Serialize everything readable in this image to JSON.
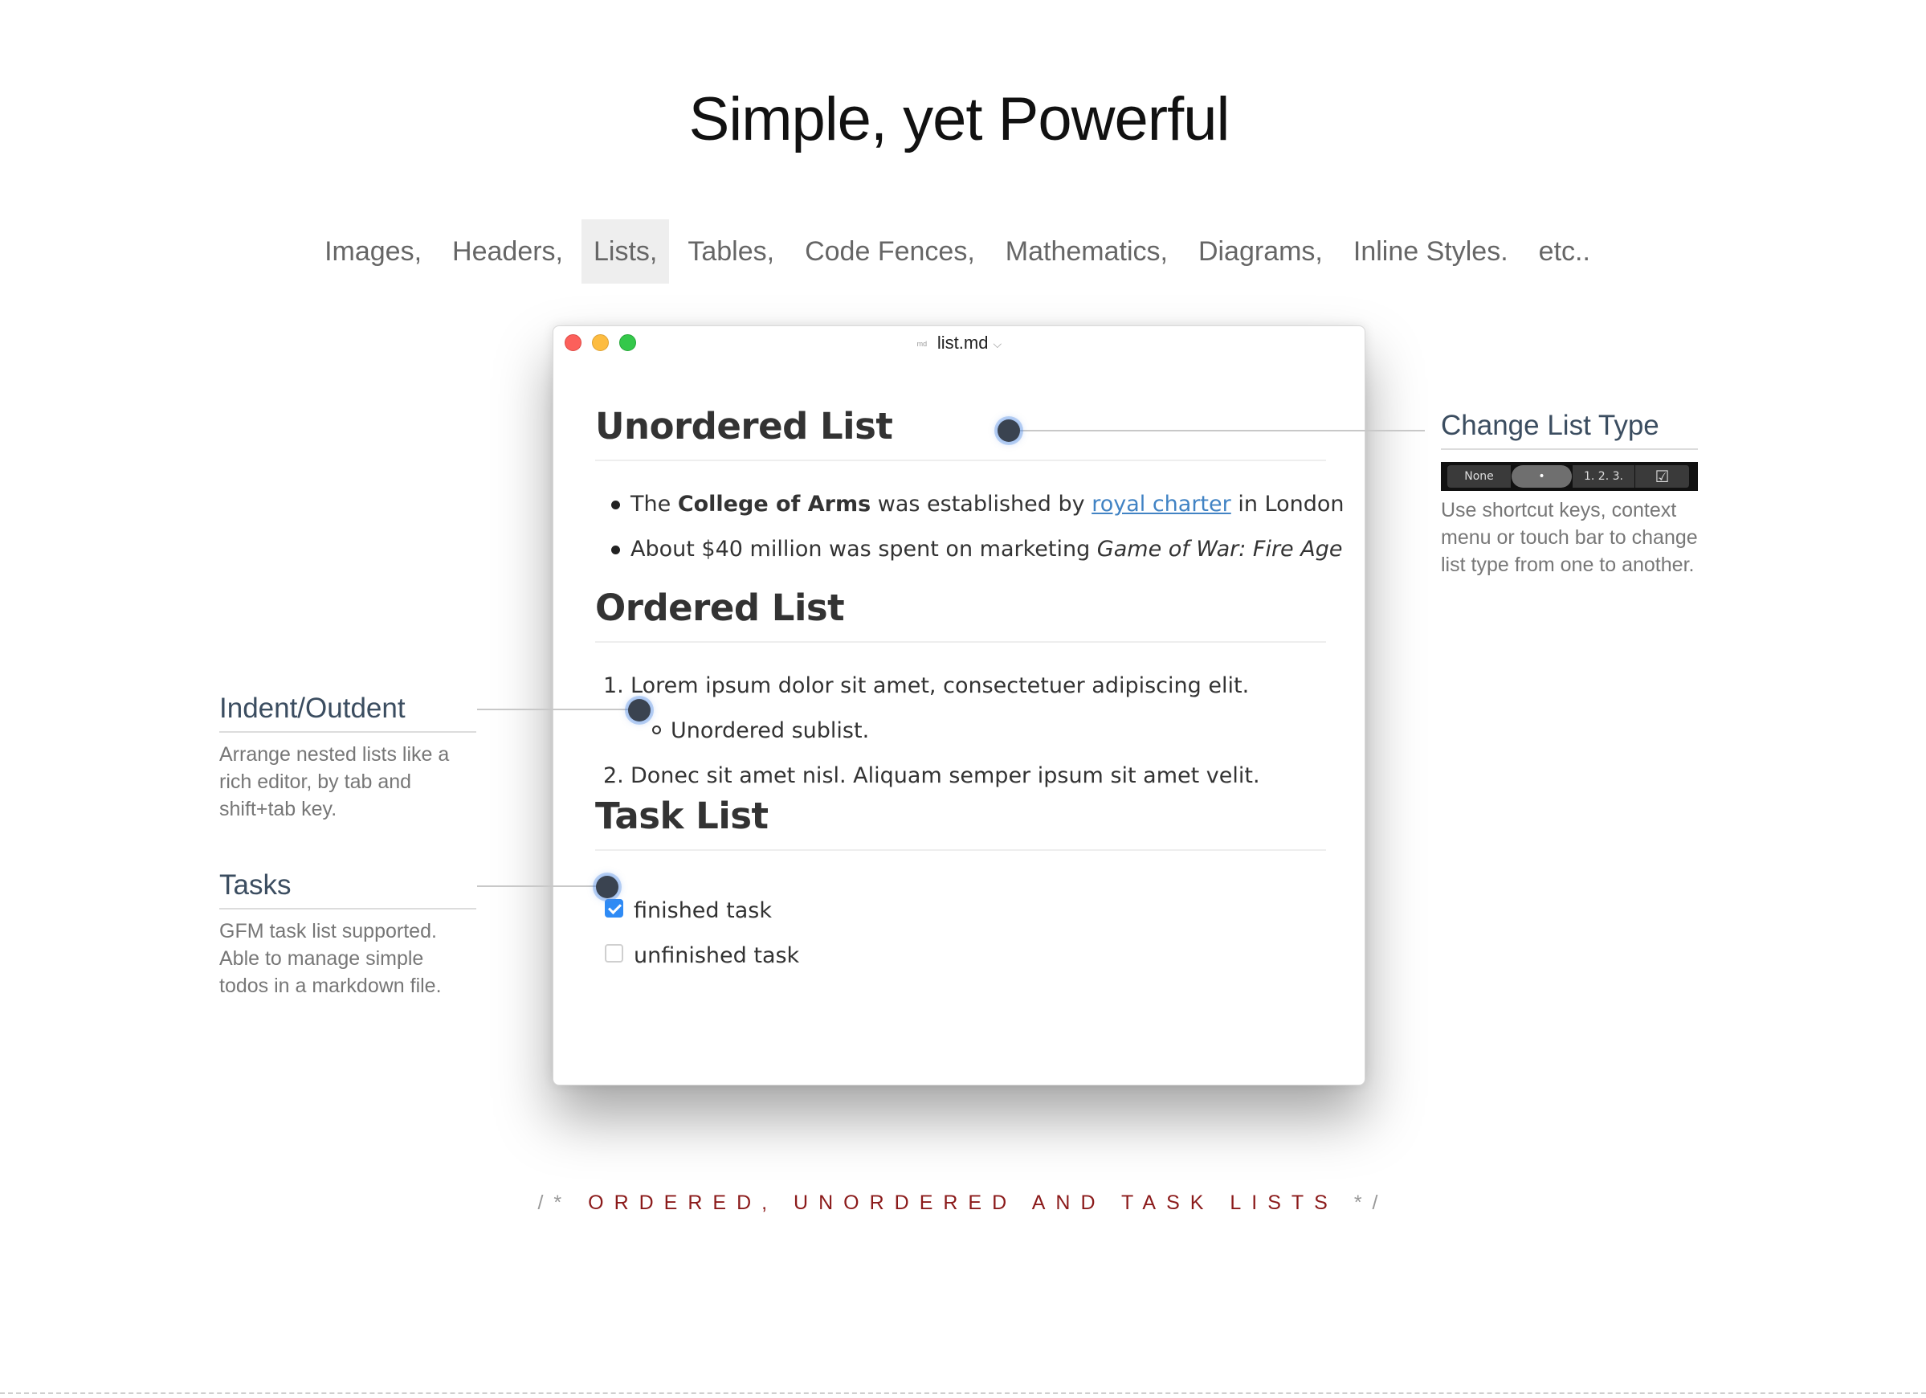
{
  "page": {
    "title": "Simple, yet Powerful",
    "features_nav": [
      "Images,",
      "Headers,",
      "Lists,",
      "Tables,",
      "Code Fences,",
      "Mathematics,",
      "Diagrams,",
      "Inline Styles.",
      "etc.."
    ],
    "active_feature": "Lists,"
  },
  "editor": {
    "file_icon_label": "md",
    "filename": "list.md",
    "filename_chevron": "⌵",
    "unordered": {
      "heading": "Unordered List",
      "item1": {
        "pre": "The ",
        "bold": "College of Arms",
        "mid": " was established by ",
        "link": "royal charter",
        "post": " in London"
      },
      "item2": {
        "pre": "About $40 million was spent on marketing ",
        "italic": "Game of War: Fire Age"
      }
    },
    "ordered": {
      "heading": "Ordered List",
      "item1_num": "1.",
      "item1": "Lorem ipsum dolor sit amet, consectetuer adipiscing elit.",
      "sub_item": "Unordered sublist.",
      "item2_num": "2.",
      "item2": "Donec sit amet nisl. Aliquam semper ipsum sit amet velit."
    },
    "tasks": {
      "heading": "Task List",
      "items": [
        {
          "label": "finished task",
          "checked": true
        },
        {
          "label": "unfinished task",
          "checked": false
        }
      ]
    }
  },
  "annotations": {
    "change_list_type": {
      "title": "Change List Type",
      "desc": "Use shortcut keys, context menu or touch bar to change list type from one to another.",
      "touchbar": {
        "none": "None",
        "bullet": "•",
        "ordered": "1. 2. 3.",
        "task": "☑"
      }
    },
    "indent": {
      "title": "Indent/Outdent",
      "desc": "Arrange nested lists like a rich editor, by tab and shift+tab key."
    },
    "tasks": {
      "title": "Tasks",
      "desc": "GFM task list supported. Able to manage simple todos in a markdown file."
    }
  },
  "footer": {
    "open": "/*",
    "text": "ORDERED, UNORDERED AND TASK LISTS",
    "close": "*/"
  },
  "colors": {
    "accent_link": "#4183c4",
    "checkbox_checked": "#2f8bf5",
    "caption": "#8b1a1a",
    "annotation_title": "#3b4d60"
  }
}
